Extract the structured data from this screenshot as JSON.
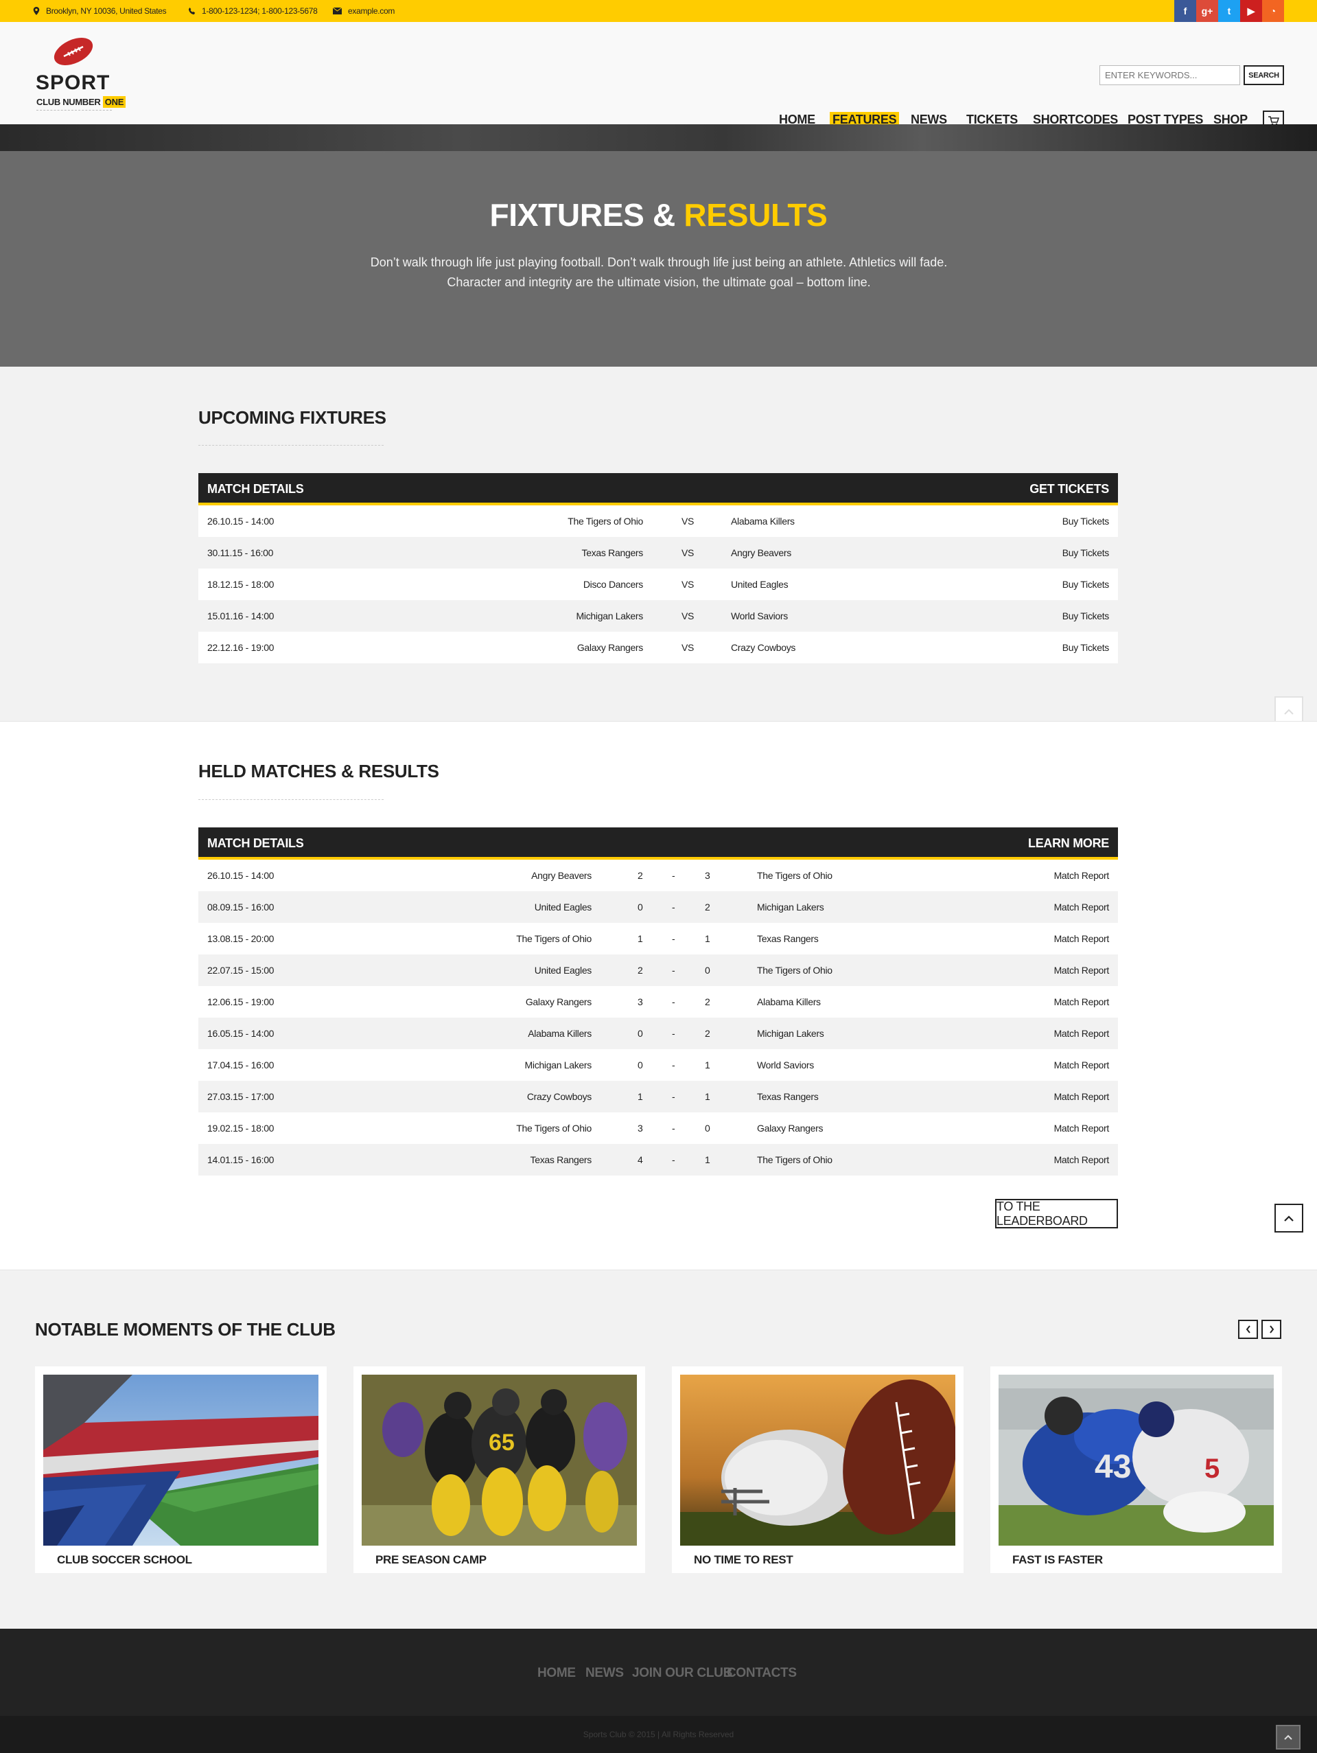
{
  "topbar": {
    "address": "Brooklyn, NY 10036, United States",
    "phone": "1-800-123-1234; 1-800-123-5678",
    "email": "example.com",
    "social": [
      {
        "icon": "facebook-icon",
        "glyph": "f",
        "color": "#3b5998"
      },
      {
        "icon": "google-plus-icon",
        "glyph": "g+",
        "color": "#dd4b39"
      },
      {
        "icon": "twitter-icon",
        "glyph": "t",
        "color": "#1da1f2"
      },
      {
        "icon": "youtube-icon",
        "glyph": "▶",
        "color": "#cd201f"
      },
      {
        "icon": "rss-icon",
        "glyph": "◔",
        "color": "#f26522"
      }
    ]
  },
  "logo": {
    "title": "SPORT",
    "subtitle": "CLUB NUMBER",
    "badge": "ONE"
  },
  "search": {
    "placeholder": "ENTER KEYWORDS...",
    "button": "SEARCH"
  },
  "nav": [
    "HOME",
    "FEATURES",
    "NEWS",
    "TICKETS",
    "SHORTCODES",
    "POST TYPES",
    "SHOP"
  ],
  "hero": {
    "title_a": "FIXTURES &",
    "title_b": "RESULTS",
    "text_1": "Don’t walk through life just playing football. Don’t walk through life just being an athlete. Athletics will fade.",
    "text_2": "Character and integrity are the ultimate vision, the ultimate goal – bottom line."
  },
  "upcoming": {
    "title": "UPCOMING FIXTURES",
    "head_left": "MATCH DETAILS",
    "head_right": "GET TICKETS",
    "rows": [
      {
        "date": "26.10.15 - 14:00",
        "home": "The Tigers of Ohio",
        "vs": "VS",
        "away": "Alabama Killers",
        "action": "Buy Tickets"
      },
      {
        "date": "30.11.15 - 16:00",
        "home": "Texas Rangers",
        "vs": "VS",
        "away": "Angry Beavers",
        "action": "Buy Tickets"
      },
      {
        "date": "18.12.15 - 18:00",
        "home": "Disco Dancers",
        "vs": "VS",
        "away": "United Eagles",
        "action": "Buy Tickets"
      },
      {
        "date": "15.01.16 - 14:00",
        "home": "Michigan Lakers",
        "vs": "VS",
        "away": "World Saviors",
        "action": "Buy Tickets"
      },
      {
        "date": "22.12.16 - 19:00",
        "home": "Galaxy Rangers",
        "vs": "VS",
        "away": "Crazy Cowboys",
        "action": "Buy Tickets"
      }
    ]
  },
  "results": {
    "title": "HELD MATCHES & RESULTS",
    "head_left": "MATCH DETAILS",
    "head_right": "LEARN MORE",
    "rows": [
      {
        "date": "26.10.15 - 14:00",
        "home": "Angry Beavers",
        "hs": "2",
        "sep": "-",
        "as": "3",
        "away": "The Tigers of Ohio",
        "action": "Match Report"
      },
      {
        "date": "08.09.15 - 16:00",
        "home": "United Eagles",
        "hs": "0",
        "sep": "-",
        "as": "2",
        "away": "Michigan Lakers",
        "action": "Match Report"
      },
      {
        "date": "13.08.15 - 20:00",
        "home": "The Tigers of Ohio",
        "hs": "1",
        "sep": "-",
        "as": "1",
        "away": "Texas Rangers",
        "action": "Match Report"
      },
      {
        "date": "22.07.15 - 15:00",
        "home": "United Eagles",
        "hs": "2",
        "sep": "-",
        "as": "0",
        "away": "The Tigers of Ohio",
        "action": "Match Report"
      },
      {
        "date": "12.06.15 - 19:00",
        "home": "Galaxy Rangers",
        "hs": "3",
        "sep": "-",
        "as": "2",
        "away": "Alabama Killers",
        "action": "Match Report"
      },
      {
        "date": "16.05.15 - 14:00",
        "home": "Alabama Killers",
        "hs": "0",
        "sep": "-",
        "as": "2",
        "away": "Michigan Lakers",
        "action": "Match Report"
      },
      {
        "date": "17.04.15 - 16:00",
        "home": "Michigan Lakers",
        "hs": "0",
        "sep": "-",
        "as": "1",
        "away": "World Saviors",
        "action": "Match Report"
      },
      {
        "date": "27.03.15 - 17:00",
        "home": "Crazy Cowboys",
        "hs": "1",
        "sep": "-",
        "as": "1",
        "away": "Texas Rangers",
        "action": "Match Report"
      },
      {
        "date": "19.02.15 - 18:00",
        "home": "The Tigers of Ohio",
        "hs": "3",
        "sep": "-",
        "as": "0",
        "away": "Galaxy Rangers",
        "action": "Match Report"
      },
      {
        "date": "14.01.15 - 16:00",
        "home": "Texas Rangers",
        "hs": "4",
        "sep": "-",
        "as": "1",
        "away": "The Tigers of Ohio",
        "action": "Match Report"
      }
    ],
    "leaderboard_button": "TO THE LEADERBOARD"
  },
  "moments": {
    "title": "NOTABLE MOMENTS OF THE CLUB",
    "cards": [
      {
        "caption": "CLUB SOCCER SCHOOL",
        "image": "stadium-image"
      },
      {
        "caption": "PRE SEASON CAMP",
        "image": "players-image"
      },
      {
        "caption": "NO TIME TO REST",
        "image": "helmet-ball-image"
      },
      {
        "caption": "FAST IS FASTER",
        "image": "tackle-image"
      }
    ]
  },
  "footer": {
    "links": [
      "HOME",
      "NEWS",
      "JOIN OUR CLUB",
      "CONTACTS"
    ],
    "copyright": "Sports Club © 2015 | All Rights Reserved"
  },
  "colors": {
    "accent": "#ffcc00",
    "dark": "#222222",
    "hero_bg": "#6b6b6b"
  }
}
